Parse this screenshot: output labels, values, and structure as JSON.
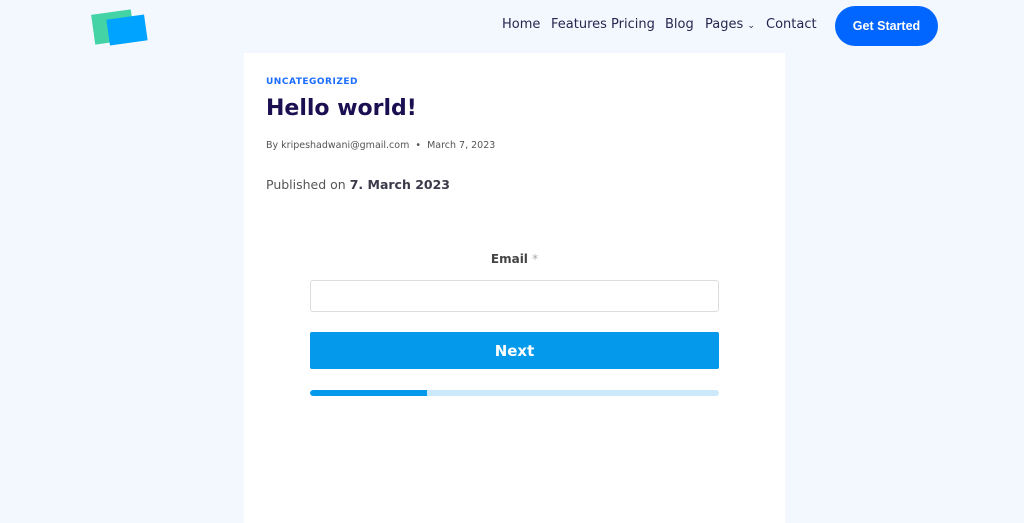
{
  "nav": {
    "items": [
      "Home",
      "Features",
      "Pricing",
      "Blog",
      "Pages",
      "Contact"
    ],
    "cta": "Get Started"
  },
  "post": {
    "category": "UNCATEGORIZED",
    "title": "Hello world!",
    "author": "By kripeshadwani@gmail.com",
    "separator": "•",
    "date": "March 7, 2023",
    "published_prefix": "Published on",
    "published_date": "7. March 2023"
  },
  "form": {
    "email_label": "Email",
    "required_mark": "*",
    "email_value": "",
    "next_label": "Next",
    "progress_percent": 28.6
  },
  "colors": {
    "accent": "#0066ff",
    "button": "#0499ea",
    "title": "#1b0f52"
  }
}
